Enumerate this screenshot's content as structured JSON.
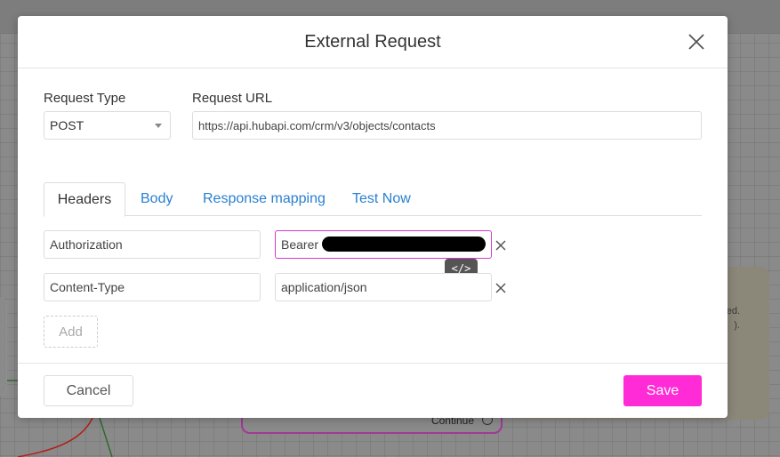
{
  "modal": {
    "title": "External Request",
    "close_icon": "close-icon"
  },
  "request": {
    "type_label": "Request Type",
    "type_value": "POST",
    "url_label": "Request URL",
    "url_value": "https://api.hubapi.com/crm/v3/objects/contacts"
  },
  "tabs": [
    {
      "label": "Headers",
      "active": true
    },
    {
      "label": "Body",
      "active": false
    },
    {
      "label": "Response mapping",
      "active": false
    },
    {
      "label": "Test Now",
      "active": false
    }
  ],
  "headers": [
    {
      "key": "Authorization",
      "value": "Bearer "
    },
    {
      "key": "Content-Type",
      "value": "application/json"
    }
  ],
  "code_toggle_icon": "code-icon",
  "code_toggle_glyph": "</>",
  "add_label": "Add",
  "footer": {
    "cancel_label": "Cancel",
    "save_label": "Save"
  },
  "background": {
    "card_text_1": "ed.",
    "card_text_2": ").",
    "continue_label": "Continue"
  },
  "colors": {
    "accent": "#ff2bd6",
    "link": "#2a7fd0",
    "focus_border": "#d23ad0"
  }
}
